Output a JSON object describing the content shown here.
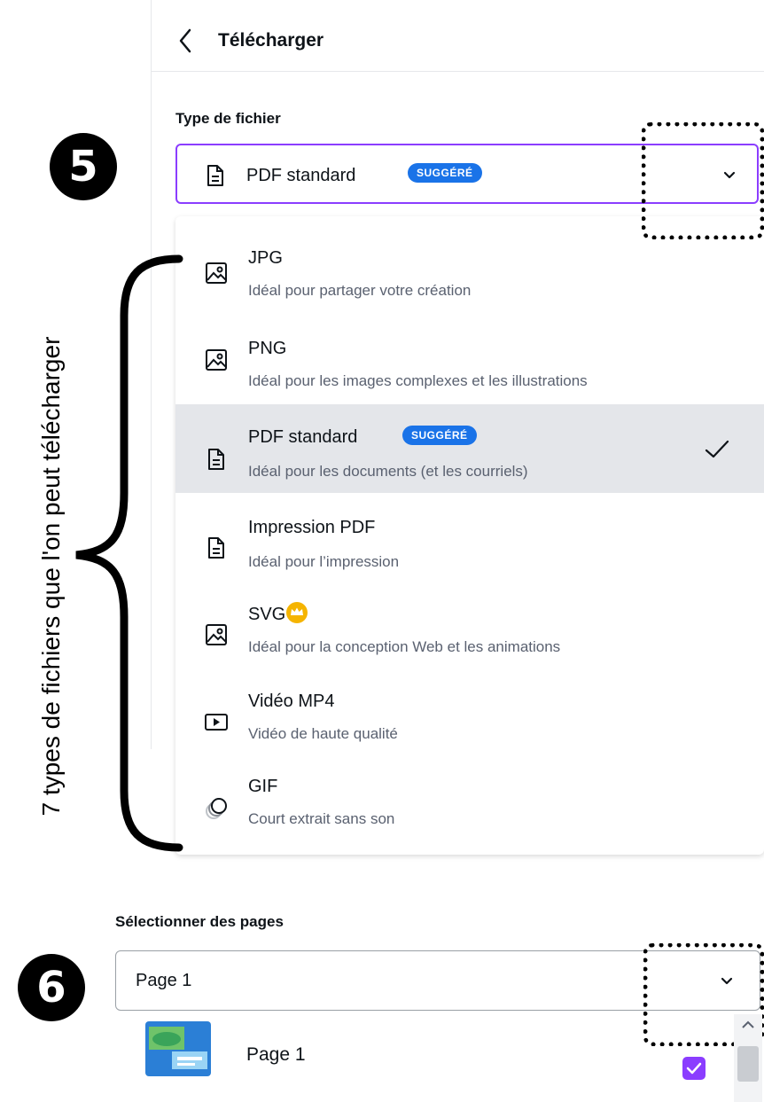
{
  "header": {
    "title": "Télécharger",
    "back_icon": "chevron-left-icon"
  },
  "file_type": {
    "label": "Type de fichier",
    "selected": "PDF standard",
    "selected_badge": "SUGGÉRÉ",
    "selected_icon": "document-icon"
  },
  "file_types": [
    {
      "name": "JPG",
      "description": "Idéal pour partager votre création",
      "icon": "image-icon",
      "badge": "",
      "selected": false
    },
    {
      "name": "PNG",
      "description": "Idéal pour les images complexes et les illustrations",
      "icon": "image-icon",
      "badge": "",
      "selected": false
    },
    {
      "name": "PDF standard",
      "description": "Idéal pour les documents (et les courriels)",
      "icon": "document-icon",
      "badge": "SUGGÉRÉ",
      "selected": true
    },
    {
      "name": "Impression PDF",
      "description": "Idéal pour l’impression",
      "icon": "document-icon",
      "badge": "",
      "selected": false
    },
    {
      "name": "SVG",
      "description": "Idéal pour la conception Web et les animations",
      "icon": "image-icon",
      "badge": "crown-icon",
      "selected": false
    },
    {
      "name": "Vidéo MP4",
      "description": "Vidéo de haute qualité",
      "icon": "video-icon",
      "badge": "",
      "selected": false
    },
    {
      "name": "GIF",
      "description": "Court extrait sans son",
      "icon": "gif-icon",
      "badge": "",
      "selected": false
    }
  ],
  "annotations": {
    "step5": "5",
    "step6": "6",
    "brace_text": "7 types de fichiers que l'on peut télécharger"
  },
  "pages": {
    "label": "Sélectionner des pages",
    "selected": "Page 1",
    "items": [
      {
        "label": "Page 1",
        "checked": true
      }
    ]
  },
  "colors": {
    "accent": "#8b3dff",
    "badge": "#1a73e8",
    "crown": "#f5b400",
    "selected_row": "#e4e6ea"
  }
}
